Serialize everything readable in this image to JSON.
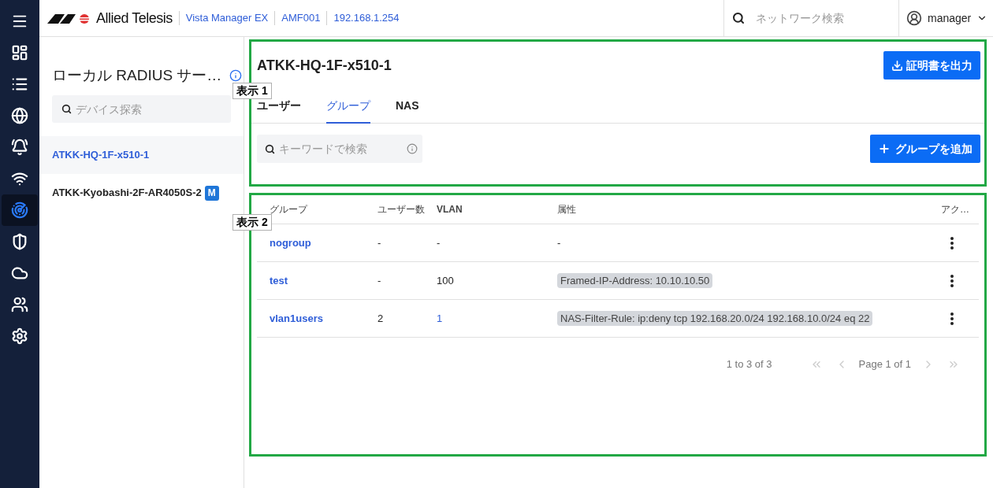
{
  "header": {
    "logo": "Allied Telesis",
    "breadcrumbs": [
      "Vista Manager EX",
      "AMF001",
      "192.168.1.254"
    ],
    "search": {
      "placeholder": "ネットワーク検索"
    },
    "user": "manager"
  },
  "nav": [
    {
      "kind": "dashboard",
      "selected": false
    },
    {
      "kind": "list",
      "selected": false
    },
    {
      "kind": "globe",
      "selected": false
    },
    {
      "kind": "alarm",
      "selected": false
    },
    {
      "kind": "wifi",
      "selected": false
    },
    {
      "kind": "radar",
      "selected": true
    },
    {
      "kind": "shield",
      "selected": false
    },
    {
      "kind": "cloud",
      "selected": false
    },
    {
      "kind": "users",
      "selected": false
    },
    {
      "kind": "settings",
      "selected": false
    }
  ],
  "sidebar": {
    "title": "ローカル RADIUS サー…",
    "search": {
      "placeholder": "デバイス探索"
    },
    "devices": [
      {
        "name": "ATKK-HQ-1F-x510-1",
        "selected": true
      },
      {
        "name": "ATKK-Kyobashi-2F-AR4050S-2",
        "selected": false,
        "badge": "M"
      }
    ]
  },
  "device": {
    "title": "ATKK-HQ-1F-x510-1",
    "export_button": "証明書を出力",
    "tabs": [
      {
        "label": "ユーザー",
        "selected": false
      },
      {
        "label": "グループ",
        "selected": true
      },
      {
        "label": "NAS",
        "selected": false
      }
    ],
    "search": {
      "placeholder": "キーワードで検索"
    },
    "add_button": "グループを追加"
  },
  "table": {
    "columns": [
      "グループ",
      "ユーザー数",
      "VLAN",
      "属性",
      "アク…"
    ],
    "rows": [
      {
        "group": "nogroup",
        "users": "-",
        "vlan": "-",
        "vlan_link": false,
        "attribute": "-",
        "attribute_chip": false
      },
      {
        "group": "test",
        "users": "-",
        "vlan": "100",
        "vlan_link": false,
        "attribute": "Framed-IP-Address: 10.10.10.50",
        "attribute_chip": true
      },
      {
        "group": "vlan1users",
        "users": "2",
        "vlan": "1",
        "vlan_link": true,
        "attribute": "NAS-Filter-Rule: ip:deny tcp 192.168.20.0/24 192.168.10.0/24 eq 22",
        "attribute_chip": true
      }
    ]
  },
  "pagination": {
    "summary": "1 to 3 of 3",
    "page": "Page 1 of 1"
  },
  "annotations": [
    {
      "label": "表示 1"
    },
    {
      "label": "表示 2"
    }
  ]
}
